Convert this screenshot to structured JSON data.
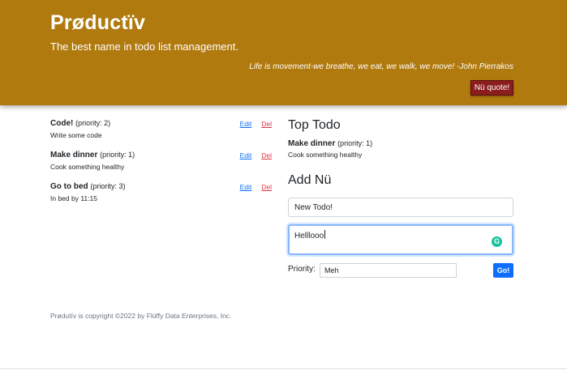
{
  "header": {
    "brand": "Prøductïv",
    "tagline": "The best name in todo list management.",
    "quote": "Life is movement-we breathe, we eat, we walk, we move! -John Pierrakos",
    "quote_button": "Nü quote!",
    "background_color": "#b07a0f"
  },
  "todos": [
    {
      "title": "Code!",
      "priority": "(priority: 2)",
      "description": "Write some code",
      "edit_label": "Edit",
      "delete_label": "Del"
    },
    {
      "title": "Make dinner",
      "priority": "(priority: 1)",
      "description": "Cook something healthy",
      "edit_label": "Edit",
      "delete_label": "Del"
    },
    {
      "title": "Go to bed",
      "priority": "(priority: 3)",
      "description": "In bed by 11:15",
      "edit_label": "Edit",
      "delete_label": "Del"
    }
  ],
  "top_todo": {
    "heading": "Top Todo",
    "title": "Make dinner",
    "priority": "(priority: 1)",
    "description": "Cook something healthy"
  },
  "add_form": {
    "heading": "Add Nü",
    "title_value": "New Todo!",
    "description_value": "Helllooo",
    "priority_label": "Priority:",
    "priority_value": "Meh",
    "submit_label": "Go!",
    "grammarly_icon": "grammarly-icon"
  },
  "footer": {
    "text": "Prødutïv is copyright ©2022 by Flüffy Data Enterprises, Inc."
  }
}
